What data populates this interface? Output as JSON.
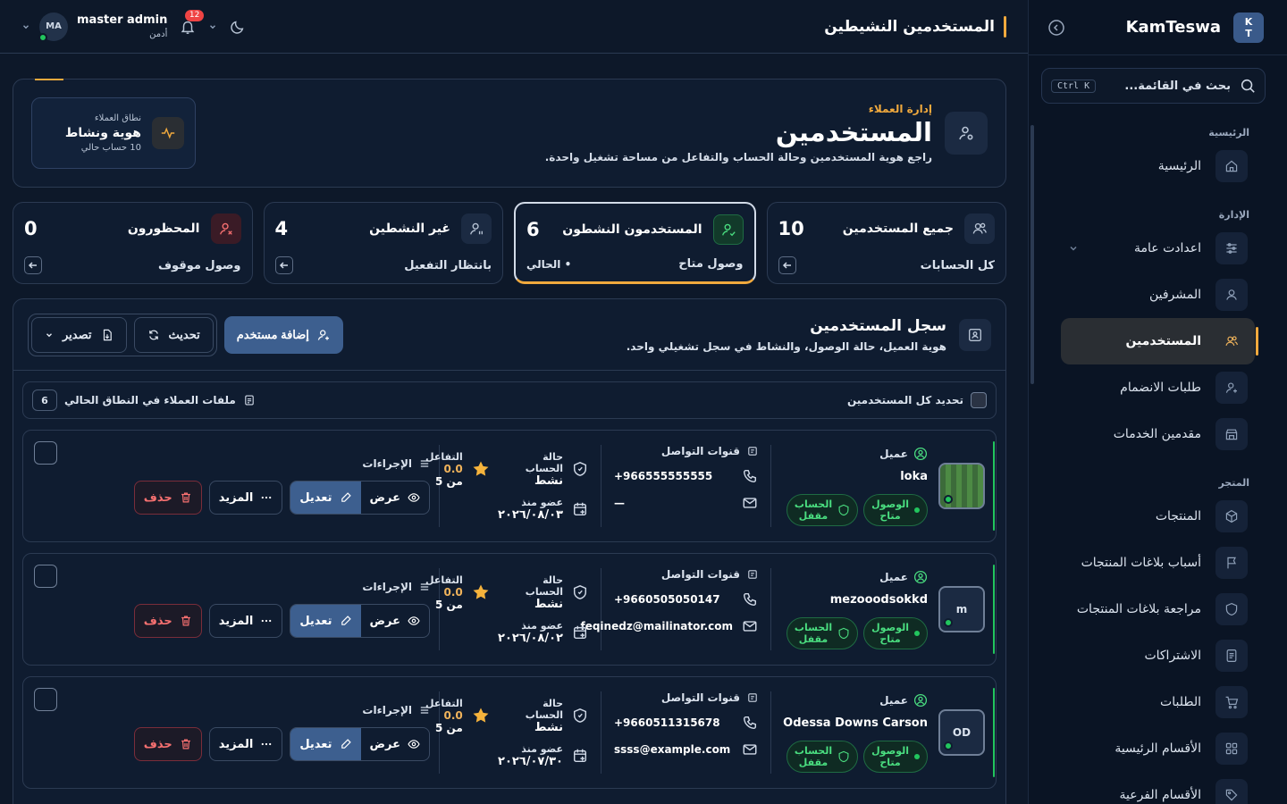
{
  "app": {
    "brand_name": "KamTeswa",
    "logo_line1": "K",
    "logo_line2": "T"
  },
  "sidebar": {
    "search_placeholder": "بحث في القائمة...",
    "search_shortcut": "Ctrl K",
    "sections": [
      {
        "label": "الرئيسية",
        "items": [
          {
            "label": "الرئيسية",
            "icon": "home-icon"
          }
        ]
      },
      {
        "label": "الإدارة",
        "items": [
          {
            "label": "اعدادت عامة",
            "icon": "sliders-icon",
            "expandable": true
          },
          {
            "label": "المشرفين",
            "icon": "user-icon"
          },
          {
            "label": "المستخدمين",
            "icon": "users-icon",
            "active": true
          },
          {
            "label": "طلبات الانضمام",
            "icon": "user-plus-icon"
          },
          {
            "label": "مقدمين الخدمات",
            "icon": "store-icon"
          }
        ]
      },
      {
        "label": "المتجر",
        "items": [
          {
            "label": "المنتجات",
            "icon": "box-icon"
          },
          {
            "label": "أسباب بلاغات المنتجات",
            "icon": "flag-icon"
          },
          {
            "label": "مراجعة بلاغات المنتجات",
            "icon": "shield-icon"
          },
          {
            "label": "الاشتراكات",
            "icon": "doc-icon"
          },
          {
            "label": "الطلبات",
            "icon": "cart-icon"
          },
          {
            "label": "الأقسام الرئيسية",
            "icon": "grid-icon"
          },
          {
            "label": "الأقسام الفرعية",
            "icon": "tag-icon"
          }
        ]
      }
    ]
  },
  "topbar": {
    "page_title": "المستخدمين النشيطين",
    "user_name": "master admin",
    "user_role": "أدمن",
    "user_initials": "MA",
    "notifications_count": "12"
  },
  "hero": {
    "eyebrow": "إدارة العملاء",
    "title": "المستخدمين",
    "description": "راجع هوية المستخدمين وحالة الحساب والتفاعل من مساحة تشغيل واحدة.",
    "scope_label": "نطاق العملاء",
    "scope_value": "هوية ونشاط",
    "scope_sub": "10 حساب حالي"
  },
  "stats": [
    {
      "title": "جميع المستخدمين",
      "value": "10",
      "sub": "كل الحسابات",
      "icon": "users-icon"
    },
    {
      "title": "المستخدمون النشطون",
      "value": "6",
      "sub": "وصول متاح",
      "current": "• الحالي",
      "icon": "user-check-icon",
      "active": true
    },
    {
      "title": "غير النشطين",
      "value": "4",
      "sub": "بانتظار التفعيل",
      "icon": "user-pause-icon"
    },
    {
      "title": "المحظورون",
      "value": "0",
      "sub": "وصول موقوف",
      "icon": "user-x-icon"
    }
  ],
  "registry": {
    "title": "سجل المستخدمين",
    "description": "هوية العميل، حالة الوصول، والنشاط في سجل تشغيلي واحد.",
    "add_label": "إضافة مستخدم",
    "refresh_label": "تحديث",
    "export_label": "تصدير",
    "select_all_label": "تحديد كل المستخدمين",
    "profiles_label": "ملفات العملاء في النطاق الحالي",
    "profiles_count": "6"
  },
  "row_labels": {
    "role": "عميل",
    "access": "الوصول\nمتاح",
    "account_lock": "الحساب\nمقفل",
    "contact_channels": "قنوات التواصل",
    "account_status": "حالة الحساب",
    "member_since": "عضو منذ",
    "engagement": "التفاعل",
    "actions": "الإجراءات",
    "view": "عرض",
    "edit": "تعديل",
    "more": "المزيد",
    "delete": "حذف",
    "out_of": "من 5"
  },
  "users": [
    {
      "name": "loka",
      "avatar": "",
      "pattern": true,
      "phone": "+966555555555",
      "email": "—",
      "status": "نشط",
      "since": "٢٠٢٦/٠٨/٠٣",
      "rating": "0.0"
    },
    {
      "name": "mezooodsokkd",
      "avatar": "m",
      "phone": "+9660505050147",
      "email": "feqinedz@mailinator.com",
      "status": "نشط",
      "since": "٢٠٢٦/٠٨/٠٢",
      "rating": "0.0"
    },
    {
      "name": "Odessa Downs Carson",
      "avatar": "OD",
      "phone": "+9660511315678",
      "email": "ssss@example.com",
      "status": "نشط",
      "since": "٢٠٢٦/٠٧/٣٠",
      "rating": "0.0"
    }
  ],
  "colors": {
    "accent": "#f0a93d",
    "primary": "#3d5f8f",
    "success": "#22c55e",
    "danger": "#f87171",
    "background": "#0d1829"
  }
}
